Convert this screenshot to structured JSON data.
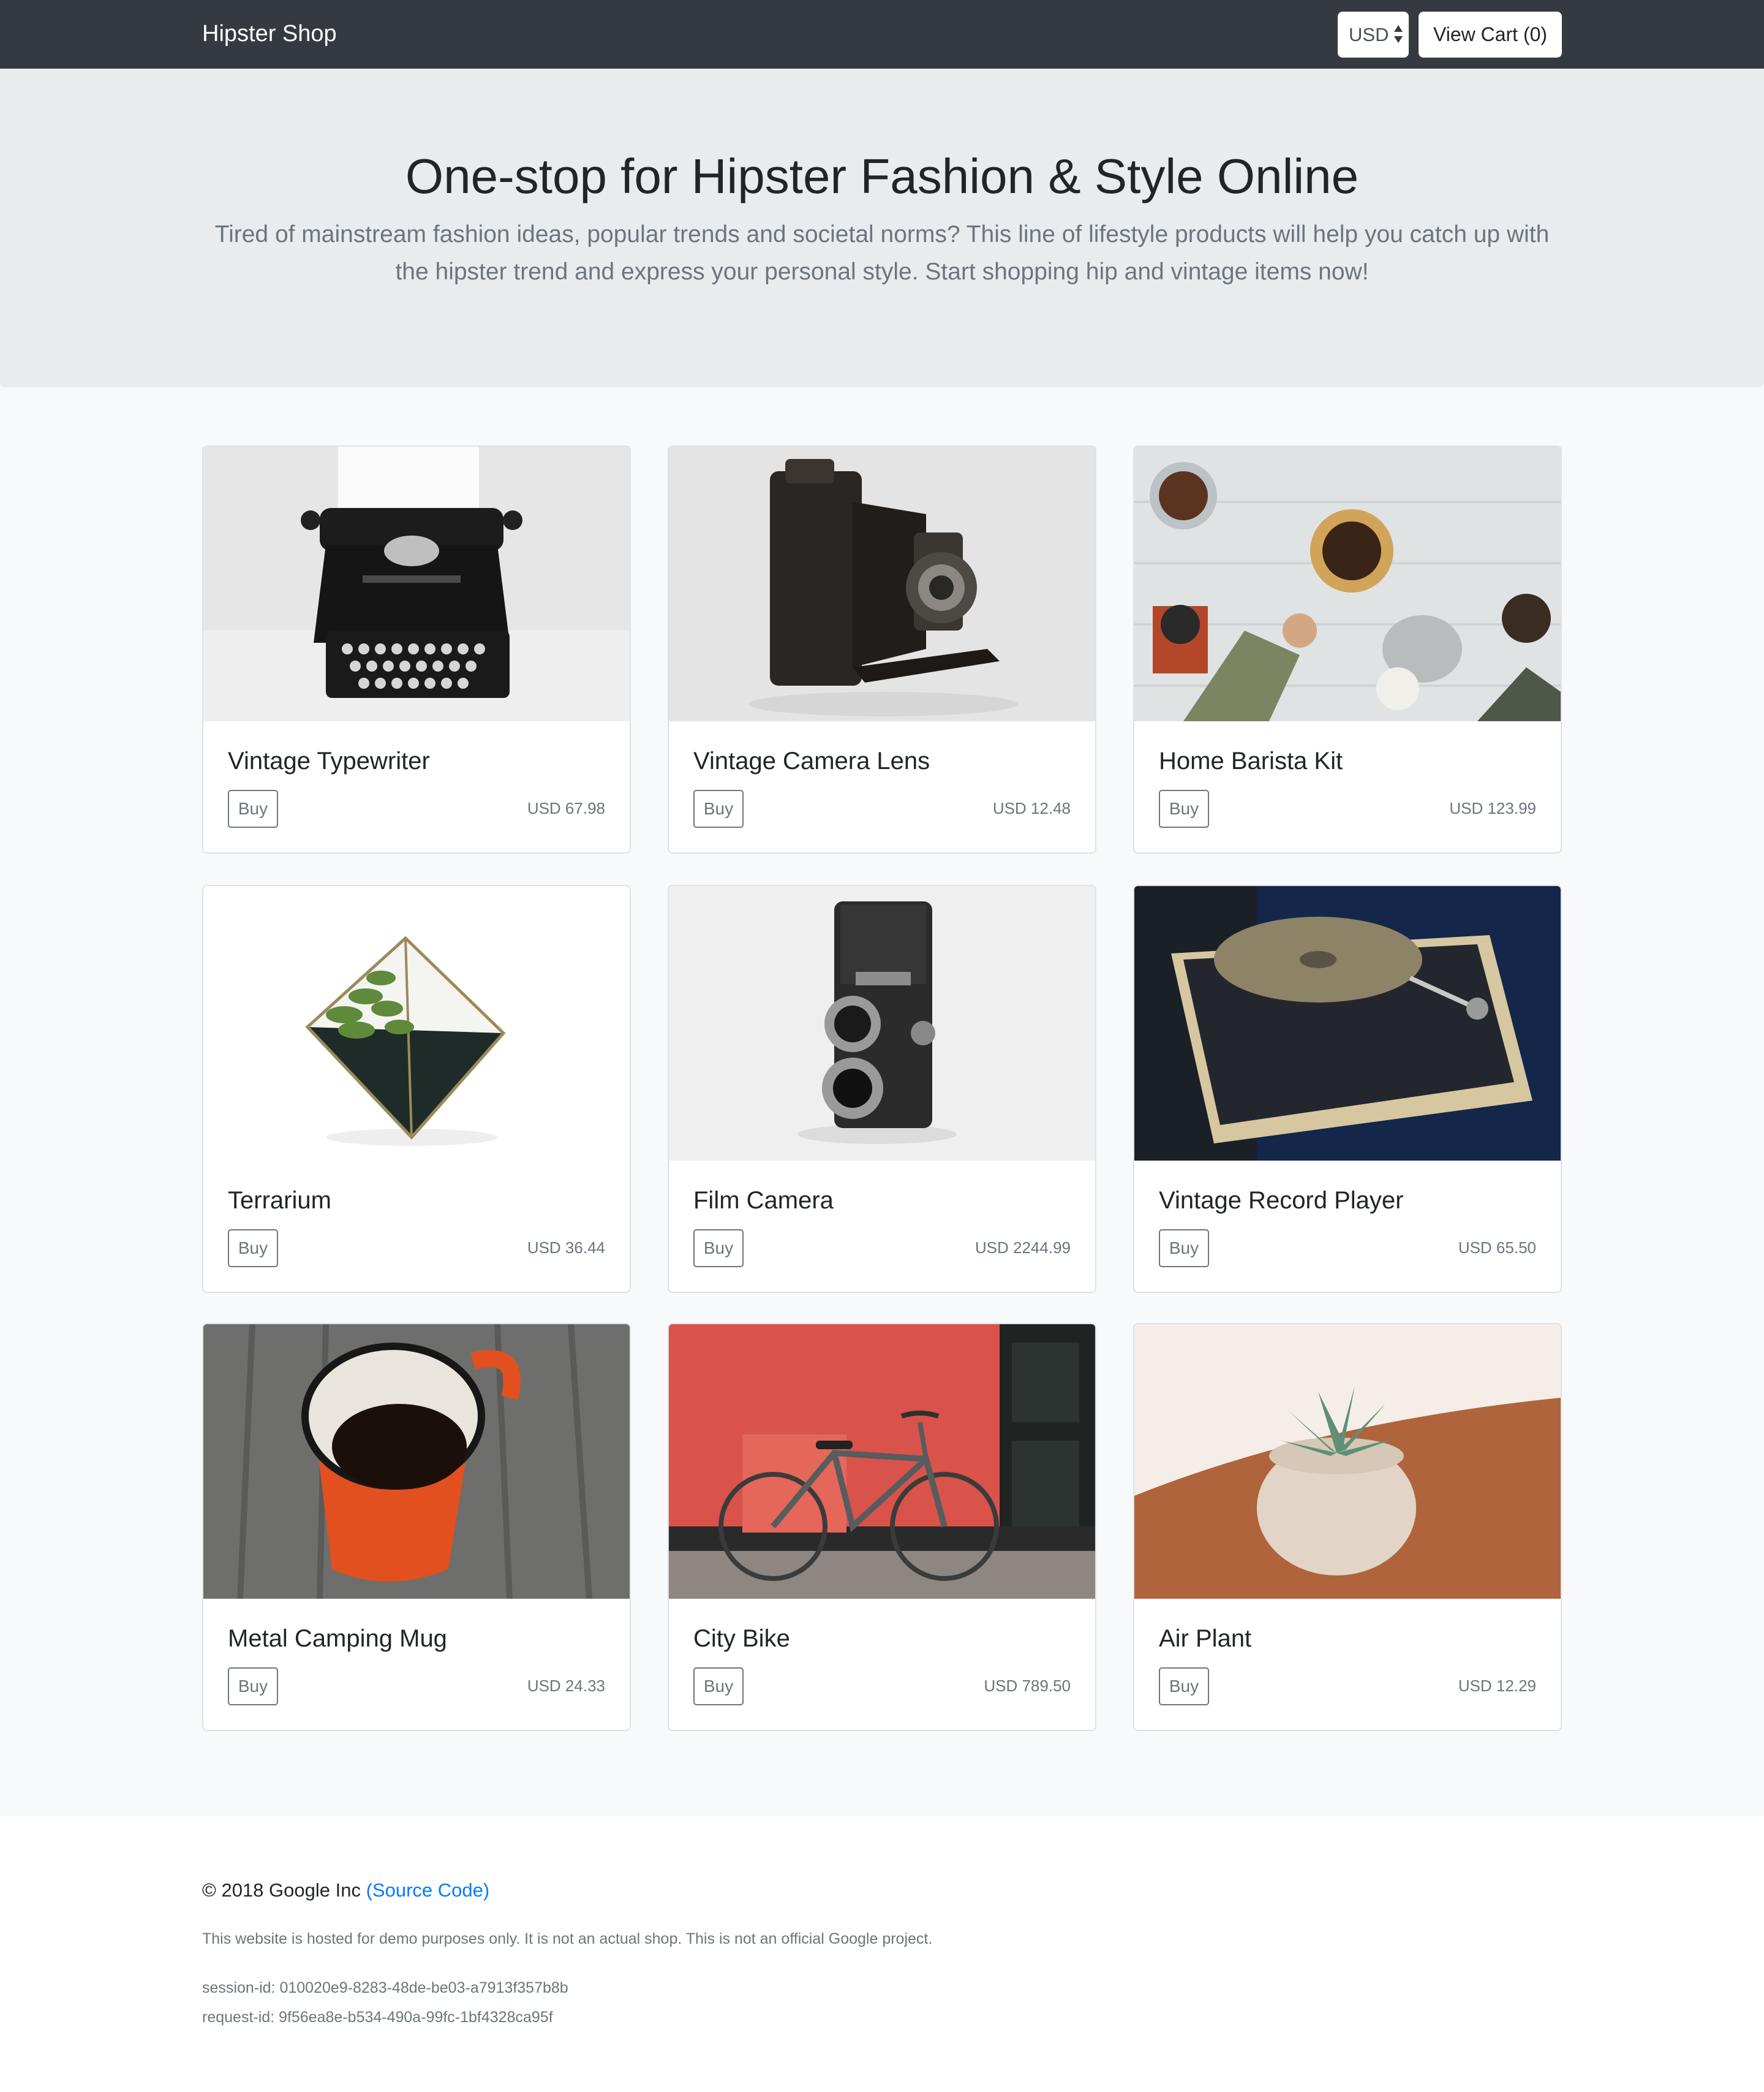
{
  "header": {
    "brand": "Hipster Shop",
    "currency": "USD",
    "cart_label": "View Cart (0)"
  },
  "hero": {
    "title": "One-stop for Hipster Fashion & Style Online",
    "subtitle": "Tired of mainstream fashion ideas, popular trends and societal norms? This line of lifestyle products will help you catch up with the hipster trend and express your personal style. Start shopping hip and vintage items now!"
  },
  "products": [
    {
      "name": "Vintage Typewriter",
      "buy_label": "Buy",
      "price": "USD 67.98"
    },
    {
      "name": "Vintage Camera Lens",
      "buy_label": "Buy",
      "price": "USD 12.48"
    },
    {
      "name": "Home Barista Kit",
      "buy_label": "Buy",
      "price": "USD 123.99"
    },
    {
      "name": "Terrarium",
      "buy_label": "Buy",
      "price": "USD 36.44"
    },
    {
      "name": "Film Camera",
      "buy_label": "Buy",
      "price": "USD 2244.99"
    },
    {
      "name": "Vintage Record Player",
      "buy_label": "Buy",
      "price": "USD 65.50"
    },
    {
      "name": "Metal Camping Mug",
      "buy_label": "Buy",
      "price": "USD 24.33"
    },
    {
      "name": "City Bike",
      "buy_label": "Buy",
      "price": "USD 789.50"
    },
    {
      "name": "Air Plant",
      "buy_label": "Buy",
      "price": "USD 12.29"
    }
  ],
  "footer": {
    "copyright": "© 2018 Google Inc",
    "source_link": "(Source Code)",
    "disclaimer": "This website is hosted for demo purposes only. It is not an actual shop. This is not an official Google project.",
    "session_id": "session-id: 010020e9-8283-48de-be03-a7913f357b8b",
    "request_id": "request-id: 9f56ea8e-b534-490a-99fc-1bf4328ca95f"
  }
}
